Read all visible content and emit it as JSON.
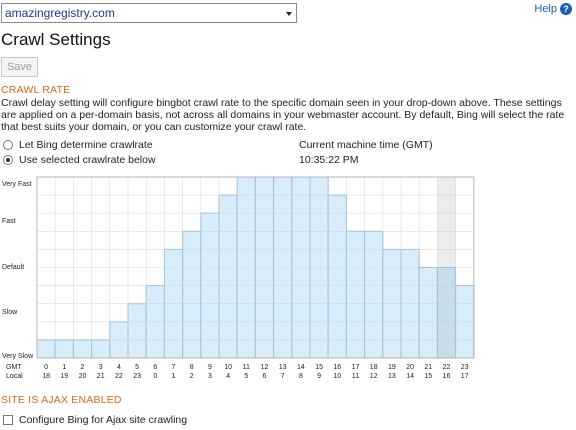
{
  "header": {
    "domain_selected": "amazingregistry.com",
    "help_label": "Help",
    "help_icon": "?"
  },
  "page_title": "Crawl Settings",
  "toolbar": {
    "save_label": "Save"
  },
  "crawl_rate": {
    "heading": "CRAWL RATE",
    "description": "Crawl delay setting will configure bingbot crawl rate to the specific domain seen in your drop-down above. These settings are applied on a per-domain basis, not across all domains in your webmaster account. By default, Bing will select the rate that best suits your domain, or you can customize your crawl rate.",
    "options": [
      "Let Bing determine crawlrate",
      "Use selected crawlrate below"
    ],
    "selected_option": 1,
    "machine_time_label": "Current machine time (GMT)",
    "machine_time_value": "10:35:22 PM"
  },
  "chart_data": {
    "type": "bar",
    "ylabels": [
      "Very Fast",
      "Fast",
      "Default",
      "Slow",
      "Very Slow"
    ],
    "ymax": 10,
    "row_label_gmt": "GMT",
    "row_label_local": "Local",
    "gmt_hours": [
      "0",
      "1",
      "2",
      "3",
      "4",
      "5",
      "6",
      "7",
      "8",
      "9",
      "10",
      "11",
      "12",
      "13",
      "14",
      "15",
      "16",
      "17",
      "18",
      "19",
      "20",
      "21",
      "22",
      "23"
    ],
    "local_hours": [
      "18",
      "19",
      "20",
      "21",
      "22",
      "23",
      "0",
      "1",
      "2",
      "3",
      "4",
      "5",
      "6",
      "7",
      "8",
      "9",
      "10",
      "11",
      "12",
      "13",
      "14",
      "15",
      "16",
      "17"
    ],
    "values": [
      1,
      1,
      1,
      1,
      2,
      3,
      4,
      6,
      7,
      8,
      9,
      10,
      10,
      10,
      10,
      10,
      9,
      7,
      7,
      6,
      6,
      5,
      5,
      4
    ],
    "highlight_index": 22,
    "colors": {
      "bar_fill": "#d8ecfa",
      "bar_stroke": "#7fbde6",
      "grid": "#cfcfcf",
      "highlight_bg": "#ececec",
      "highlight_fill": "#c9dcea"
    }
  },
  "ajax": {
    "heading": "SITE IS AJAX ENABLED",
    "checkbox_label": "Configure Bing for Ajax site crawling",
    "checked": false
  }
}
